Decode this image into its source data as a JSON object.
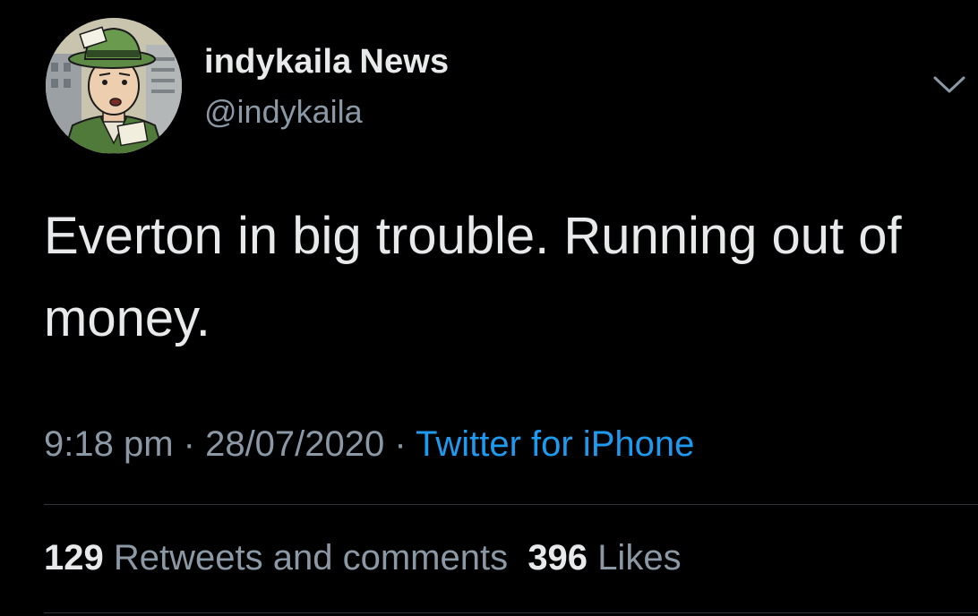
{
  "author": {
    "display_name": "indykaila",
    "label": "News",
    "handle": "@indykaila",
    "avatar_icon": "cartoon-reporter-avatar"
  },
  "menu": {
    "icon": "chevron-down-icon"
  },
  "tweet": {
    "text": "Everton in big trouble. Running out of money."
  },
  "meta": {
    "time": "9:18 pm",
    "sep1": " · ",
    "date": "28/07/2020",
    "sep2": " · ",
    "source": "Twitter for iPhone"
  },
  "stats": {
    "retweets_count": "129",
    "retweets_label": "Retweets and comments",
    "likes_count": "396",
    "likes_label": "Likes"
  },
  "colors": {
    "background": "#000000",
    "primary_text": "#e7e9ea",
    "secondary_text": "#8b98a5",
    "link": "#1d9bf0",
    "divider": "#2f3336"
  }
}
